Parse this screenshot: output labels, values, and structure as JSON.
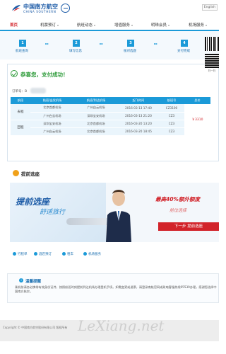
{
  "header": {
    "logo_cn": "中国南方航空",
    "logo_en": "CHINA SOUTHERN",
    "top_link": "English"
  },
  "nav": {
    "items": [
      {
        "label": "首页",
        "active": true
      },
      {
        "label": "机票预订",
        "active": false
      },
      {
        "label": "航班动态",
        "active": false
      },
      {
        "label": "增值服务",
        "active": false
      },
      {
        "label": "明珠会员",
        "active": false
      },
      {
        "label": "机场服务",
        "active": false
      }
    ]
  },
  "steps": [
    {
      "num": "1",
      "label": "航班查询"
    },
    {
      "num": "2",
      "label": "填写信息"
    },
    {
      "num": "3",
      "label": "核对选座"
    },
    {
      "num": "4",
      "label": "支付完成"
    }
  ],
  "success": {
    "message": "恭喜您，支付成功！",
    "order_label": "订单号：B"
  },
  "table": {
    "headers": [
      "航段",
      "航班/出发机场",
      "航班/到达机场",
      "起飞时间",
      "航班号",
      "总价"
    ],
    "rows": [
      {
        "leg": "去程",
        "from": "北京首都机场",
        "to": "广州白云机场",
        "time": "2016-03-13  17:40",
        "flight": "CZ3100"
      },
      {
        "leg": "",
        "from": "广州白云机场",
        "to": "深圳宝安机场",
        "time": "2016-03-13  21:20",
        "flight": "CZ3"
      },
      {
        "leg": "回程",
        "from": "深圳宝安机场",
        "to": "北京首都机场",
        "time": "2016-03-20  13:20",
        "flight": "CZ3"
      },
      {
        "leg": "",
        "from": "广州白云机场",
        "to": "北京首都机场",
        "time": "2016-03-20  18:45",
        "flight": "CZ3"
      }
    ],
    "total": "￥3310"
  },
  "qr": {
    "caption": "扫一扫"
  },
  "seat": {
    "title": "提前选座",
    "banner_title": "提前选座",
    "banner_sub": "舒适旅行",
    "banner_offer": "最高40%额外额度",
    "banner_note": "舱位选择",
    "banner_button": "下一步 提前选座"
  },
  "links": [
    {
      "label": "行程单"
    },
    {
      "label": "酒店预订"
    },
    {
      "label": "租车"
    },
    {
      "label": "机场服务"
    }
  ],
  "tips": {
    "title": "温馨提醒",
    "body": "乘机前请务必携带有效身份证件，按照航班时刻提前到达机场办理登机手续。如需变更或退票，请登录南航官网或致电客服热线95539办理，感谢您选择中国南方航空。"
  },
  "footer": {
    "text": "Copyright © 中国南方航空股份有限公司 版权所有"
  },
  "watermark": "LeXiang.net"
}
